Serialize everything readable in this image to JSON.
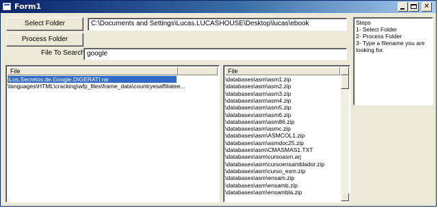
{
  "window": {
    "title": "Form1"
  },
  "buttons": {
    "select_folder": "Select Folder",
    "process_folder": "Process Folder"
  },
  "folder_path": "C:\\Documents and Settings\\Lucas.LUCASHOUSE\\Desktop\\lucas\\ebook",
  "search": {
    "label": "File To Search >",
    "value": "google"
  },
  "results_list": {
    "header": "File",
    "rows": [
      {
        "text": "\\Los.Secretos.de.Google.DIGERATI.rar",
        "selected": true
      },
      {
        "text": "\\languages\\HTML\\cracking\\wfp_files\\frame_data\\countryesaffiliatee...",
        "selected": false
      }
    ]
  },
  "files_list": {
    "header": "File",
    "rows": [
      "\\databases\\asm\\asm1.zip",
      "\\databases\\asm\\asm2.zip",
      "\\databases\\asm\\asm3.zip",
      "\\databases\\asm\\asm4.zip",
      "\\databases\\asm\\asm5.zip",
      "\\databases\\asm\\asm6.zip",
      "\\databases\\asm\\asm86.zip",
      "\\databases\\asm\\asmc.zip",
      "\\databases\\asm\\ASMCOL1.zip",
      "\\databases\\asm\\asmdoc25.zip",
      "\\databases\\asm\\CMASMAS1.TXT",
      "\\databases\\asm\\cursoasm.arj",
      "\\databases\\asm\\cursoensamblador.zip",
      "\\databases\\asm\\curso_esm.zip",
      "\\databases\\asm\\ensam.zip",
      "\\databases\\asm\\ensamb.zip",
      "\\databases\\asm\\ensambla.zip"
    ]
  },
  "steps": [
    "Steps",
    "1- Select Folder",
    "2- Process Folder",
    "3- Type a filename you are",
    "looking for."
  ]
}
